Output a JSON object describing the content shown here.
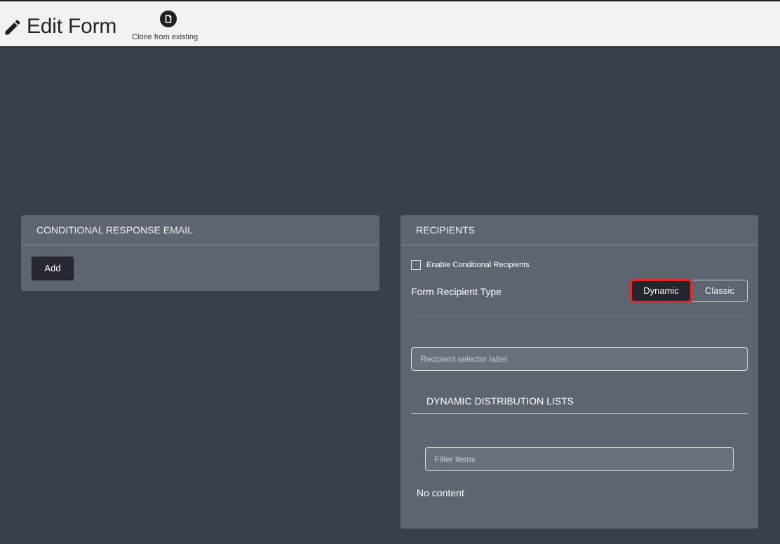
{
  "header": {
    "title": "Edit Form",
    "clone_label": "Clone from existing"
  },
  "conditional_email": {
    "title": "CONDITIONAL RESPONSE EMAIL",
    "add_label": "Add"
  },
  "recipients": {
    "title": "RECIPIENTS",
    "enable_label": "Enable Conditional Recipients",
    "enable_checked": false,
    "type_label": "Form Recipient Type",
    "type_options": [
      "Dynamic",
      "Classic"
    ],
    "type_selected": "Dynamic",
    "selector_placeholder": "Recipient selector label",
    "ddl_title": "DYNAMIC DISTRIBUTION LISTS",
    "filter_placeholder": "Filter items",
    "empty_text": "No content"
  },
  "icons": {
    "title_icon": "pencil-icon",
    "clone_icon": "document-icon"
  },
  "colors": {
    "background": "#3a4049",
    "header": "#f2f2f2",
    "panel": "#5d6570",
    "button_dark": "#262a30",
    "highlight": "#e02828"
  }
}
